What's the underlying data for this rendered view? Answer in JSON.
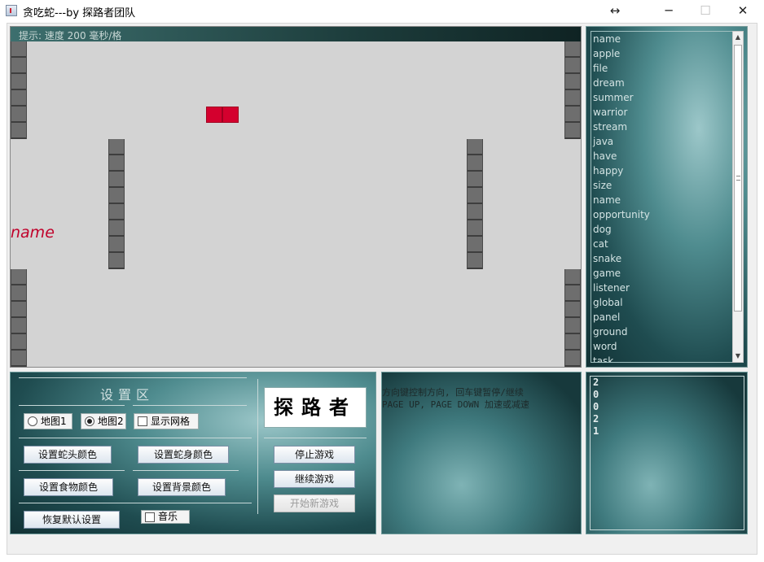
{
  "window": {
    "title": "贪吃蛇---by 探路者团队",
    "resize_glyph": "↔",
    "minimize_glyph": "─",
    "maximize_glyph": "☐",
    "close_glyph": "✕"
  },
  "game": {
    "hint": "提示: 速度 200 毫秒/格",
    "current_word": "name",
    "snake_color": "#d4002e",
    "background_color": "#d3d3d3"
  },
  "wordlist": {
    "items": [
      "name",
      "apple",
      "file",
      "dream",
      "summer",
      "warrior",
      "stream",
      "java",
      "have",
      "happy",
      "size",
      "name",
      "opportunity",
      "dog",
      "cat",
      "snake",
      "game",
      "listener",
      "global",
      "panel",
      "ground",
      "word",
      "task"
    ],
    "scroll_up": "▲",
    "scroll_down": "▼"
  },
  "settings": {
    "title": "设置区",
    "map1": "地图1",
    "map2": "地图2",
    "show_grid": "显示网格",
    "snake_head_color": "设置蛇头颜色",
    "snake_body_color": "设置蛇身颜色",
    "food_color": "设置食物颜色",
    "bg_color": "设置背景颜色",
    "restore_defaults": "恢复默认设置",
    "music": "音乐",
    "logo": "探路者",
    "stop_game": "停止游戏",
    "continue_game": "继续游戏",
    "new_game": "开始新游戏"
  },
  "instructions": {
    "line1": "方向键控制方向, 回车键暂停/继续",
    "line2": "PAGE UP, PAGE DOWN 加速或减速"
  },
  "score": {
    "digits": [
      "2",
      "0",
      "0",
      "2",
      "1"
    ]
  }
}
